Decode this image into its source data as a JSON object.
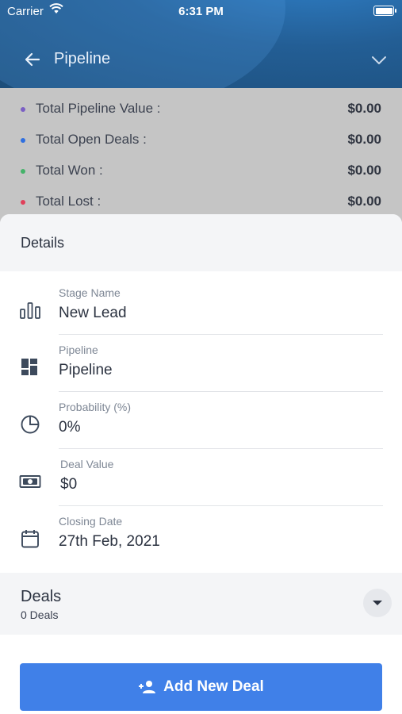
{
  "status_bar": {
    "carrier": "Carrier",
    "time": "6:31 PM"
  },
  "header": {
    "title": "Pipeline"
  },
  "summary": [
    {
      "label": "Total Pipeline Value :",
      "value": "$0.00",
      "color": "#7b5fc4"
    },
    {
      "label": "Total Open Deals :",
      "value": "$0.00",
      "color": "#2f6fe0"
    },
    {
      "label": "Total Won :",
      "value": "$0.00",
      "color": "#45b36a"
    },
    {
      "label": "Total Lost :",
      "value": "$0.00",
      "color": "#e0405a"
    }
  ],
  "details": {
    "title": "Details",
    "fields": [
      {
        "label": "Stage Name",
        "value": "New Lead",
        "icon": "bar-chart-icon"
      },
      {
        "label": "Pipeline",
        "value": "Pipeline",
        "icon": "dashboard-icon"
      },
      {
        "label": "Probability (%)",
        "value": "0%",
        "icon": "pie-chart-icon"
      },
      {
        "label": "Deal Value",
        "value": "$0",
        "icon": "money-icon"
      },
      {
        "label": "Closing Date",
        "value": "27th Feb, 2021",
        "icon": "calendar-icon"
      }
    ]
  },
  "deals": {
    "title": "Deals",
    "count": "0 Deals"
  },
  "add_button": {
    "label": "Add New Deal"
  },
  "colors": {
    "accent": "#4080e8",
    "header": "#235e95"
  }
}
